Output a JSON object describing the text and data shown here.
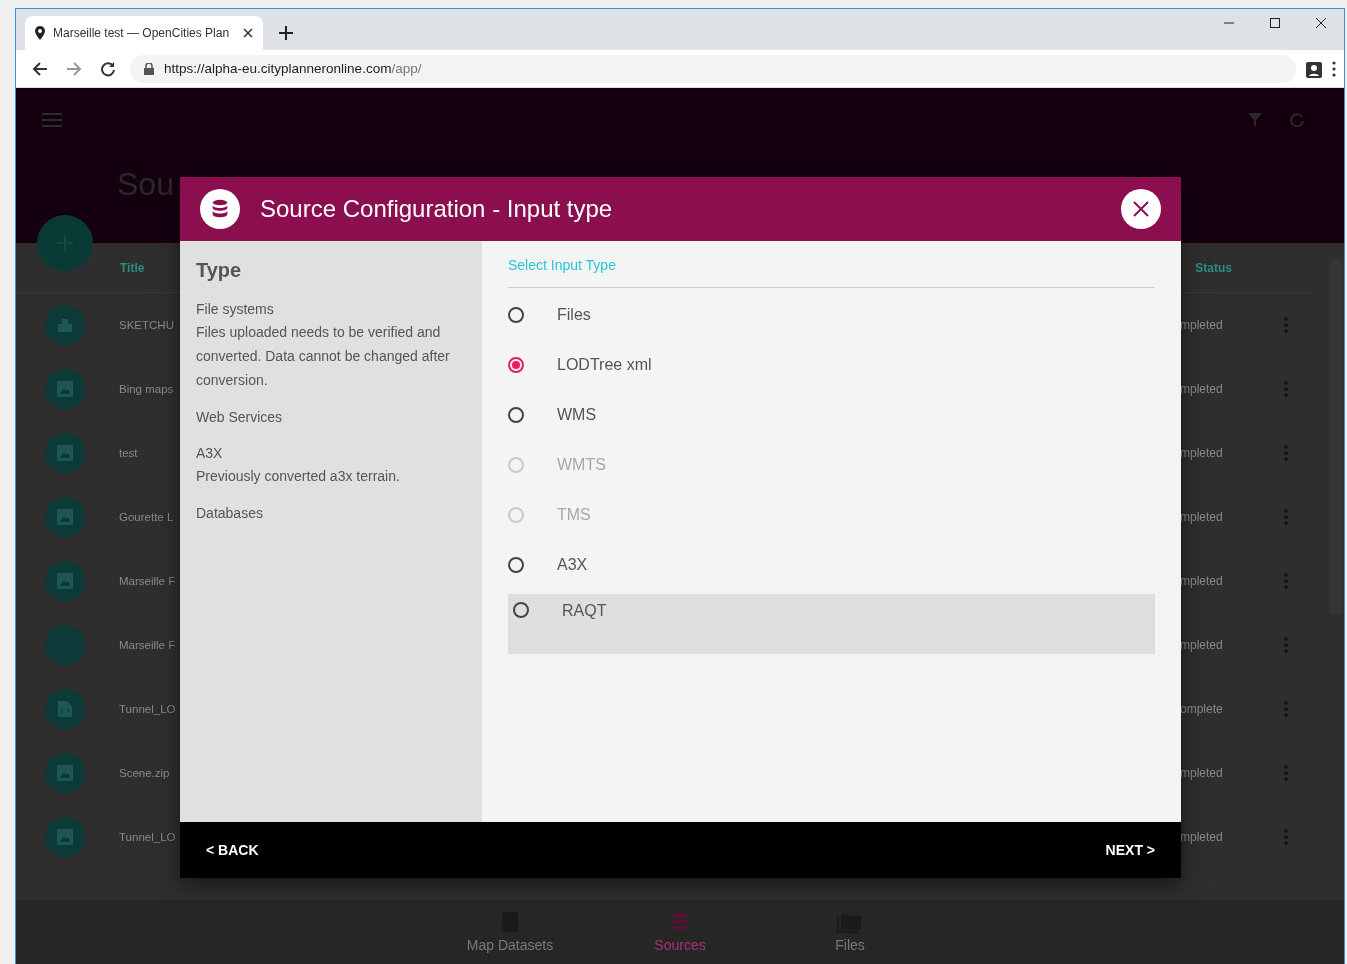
{
  "browser": {
    "tab_title": "Marseille test — OpenCities Plan",
    "url_host": "https://alpha-eu.cityplanneronline.com",
    "url_path": "/app/"
  },
  "app": {
    "page_title": "Sou",
    "columns": {
      "title": "Title",
      "status": "Status"
    },
    "rows": [
      {
        "kind": "building",
        "title": "SKETCHU",
        "status": "mpleted"
      },
      {
        "kind": "image",
        "title": "Bing maps",
        "status": "mpleted"
      },
      {
        "kind": "image",
        "title": "test",
        "status": "mpleted"
      },
      {
        "kind": "image",
        "title": "Gourette L",
        "status": "mpleted"
      },
      {
        "kind": "image",
        "title": "Marseille F",
        "status": "mpleted"
      },
      {
        "kind": "blank",
        "title": "Marseille F",
        "status": "mpleted"
      },
      {
        "kind": "code",
        "title": "Tunnel_LO",
        "status": "omplete"
      },
      {
        "kind": "image",
        "title": "Scene.zip",
        "status": "mpleted"
      },
      {
        "kind": "image",
        "title": "Tunnel_LO",
        "status": "mpleted"
      }
    ],
    "bottom_nav": [
      {
        "kind": "book",
        "label": "Map Datasets",
        "selected": false
      },
      {
        "kind": "database",
        "label": "Sources",
        "selected": true
      },
      {
        "kind": "folder",
        "label": "Files",
        "selected": false
      }
    ]
  },
  "dialog": {
    "title": "Source Configuration - Input type",
    "side_heading": "Type",
    "sections": [
      {
        "heading": "File systems",
        "description": "Files uploaded needs to be verified and converted. Data cannot be changed after conversion."
      },
      {
        "heading": "Web Services"
      },
      {
        "heading": "A3X",
        "description": "Previously converted a3x terrain."
      },
      {
        "heading": "Databases"
      }
    ],
    "select_label": "Select Input Type",
    "options": [
      {
        "label": "Files",
        "selected": false,
        "disabled": false,
        "highlighted": false
      },
      {
        "label": "LODTree xml",
        "selected": true,
        "disabled": false,
        "highlighted": false
      },
      {
        "label": "WMS",
        "selected": false,
        "disabled": false,
        "highlighted": false
      },
      {
        "label": "WMTS",
        "selected": false,
        "disabled": true,
        "highlighted": false
      },
      {
        "label": "TMS",
        "selected": false,
        "disabled": true,
        "highlighted": false
      },
      {
        "label": "A3X",
        "selected": false,
        "disabled": false,
        "highlighted": false
      },
      {
        "label": "RAQT",
        "selected": false,
        "disabled": false,
        "highlighted": true
      }
    ],
    "back": "< BACK",
    "next": "NEXT >"
  }
}
